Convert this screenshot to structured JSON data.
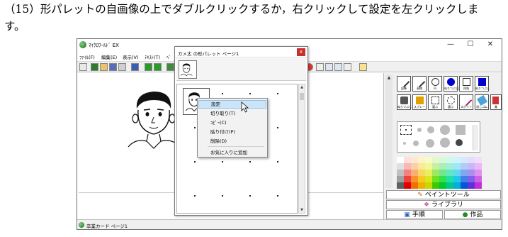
{
  "doc": {
    "line1": "（15）形パレットの自画像の上でダブルクリックするか，右クリックして設定を左クリックしま",
    "line2": "す。"
  },
  "app": {
    "title": "ﾏｲｸﾛﾜｰﾙﾄﾞ EX",
    "controls": {
      "minimize": "—",
      "maximize": "☐",
      "close": "✕"
    },
    "menu": [
      "ﾌｧｲﾙ(F)",
      "編集(E)",
      "表示(V)",
      "ﾃｷｽﾄ(T)",
      "ﾍﾟ"
    ],
    "toolbar_icons": [
      "page-icon",
      "record-icon",
      "open-folder-icon",
      "save-icon",
      "print-icon",
      "book-icon",
      "back-arrow-icon",
      "forward-arrow-icon",
      "tree-icon"
    ],
    "toolbar_right_icons": [
      "red-circle-icon",
      "scissors-icon",
      "copy-icon",
      "paste-icon",
      "undo-icon",
      "help-icon"
    ],
    "status": "卒業カード ページ1"
  },
  "tool_panel": {
    "tools_row1": [
      "鉛筆",
      "直線",
      "円",
      "ぬりつぶし円",
      "四角",
      "ぬりつぶし"
    ],
    "tools_row2": [
      "ぬりつぶし",
      "スプレー",
      "選ぶ",
      "選ぶ",
      "スポイト",
      "消しゴム",
      "美"
    ],
    "paint_tool": "ペイントツール",
    "library": "ライブラリ",
    "steps": "手順",
    "works": "作品",
    "accent": "#0000cc"
  },
  "palette_window": {
    "title": "カメ太 の形パレット ページ1",
    "close": "x"
  },
  "context_menu": {
    "items": [
      "設定",
      "切り取り(T)",
      "ｺﾋﾟｰ(C)",
      "貼り付け(P)",
      "削除(D)"
    ],
    "extra": "お気に入りに追加",
    "highlighted": "設定"
  },
  "colors": {
    "palette_title_close": "#c9302c",
    "highlight": "#cce4f7"
  }
}
